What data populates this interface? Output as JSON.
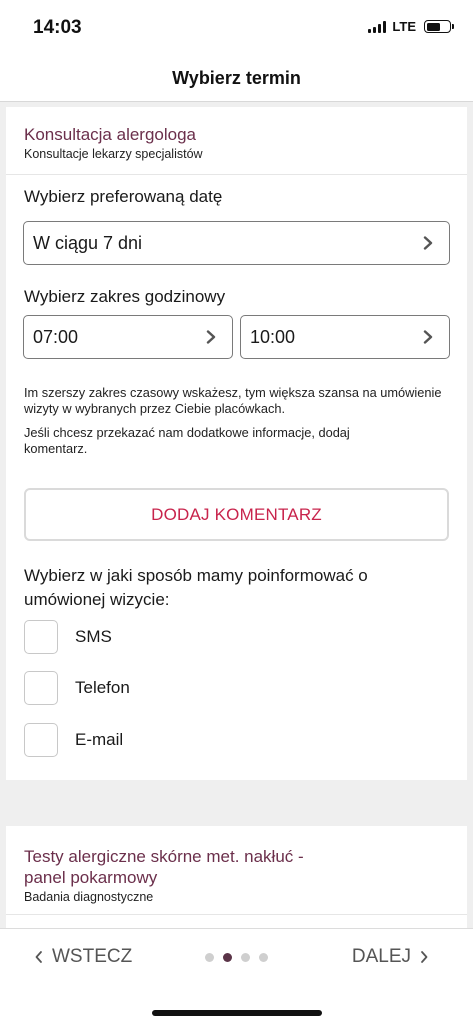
{
  "status": {
    "time": "14:03",
    "network": "LTE",
    "battery_level": 0.6
  },
  "header": {
    "title": "Wybierz termin"
  },
  "service": {
    "title": "Konsultacja alergologa",
    "subtitle": "Konsultacje lekarzy specjalistów"
  },
  "date": {
    "label": "Wybierz preferowaną datę",
    "value": "W ciągu 7 dni"
  },
  "time_range": {
    "label": "Wybierz zakres godzinowy",
    "from": "07:00",
    "to": "10:00"
  },
  "info": {
    "line1": "Im szerszy zakres czasowy wskażesz, tym większa szansa na umówienie wizyty w wybranych przez Ciebie placówkach.",
    "line2": "Jeśli chcesz przekazać nam dodatkowe informacje, dodaj komentarz."
  },
  "comment_button": {
    "label": "DODAJ KOMENTARZ"
  },
  "notify": {
    "question": "Wybierz w jaki sposób mamy poinformować o umówionej wizycie:",
    "options": [
      {
        "label": "SMS",
        "checked": false
      },
      {
        "label": "Telefon",
        "checked": false
      },
      {
        "label": "E-mail",
        "checked": false
      }
    ]
  },
  "next_service": {
    "title": "Testy alergiczne skórne met. nakłuć - panel pokarmowy",
    "subtitle": "Badania diagnostyczne"
  },
  "footer": {
    "back_label": "WSTECZ",
    "next_label": "DALEJ",
    "page_index": 2,
    "page_count": 4
  },
  "colors": {
    "accent": "#c8244c",
    "service_title": "#6b2f4b",
    "active_dot": "#5b3448"
  }
}
